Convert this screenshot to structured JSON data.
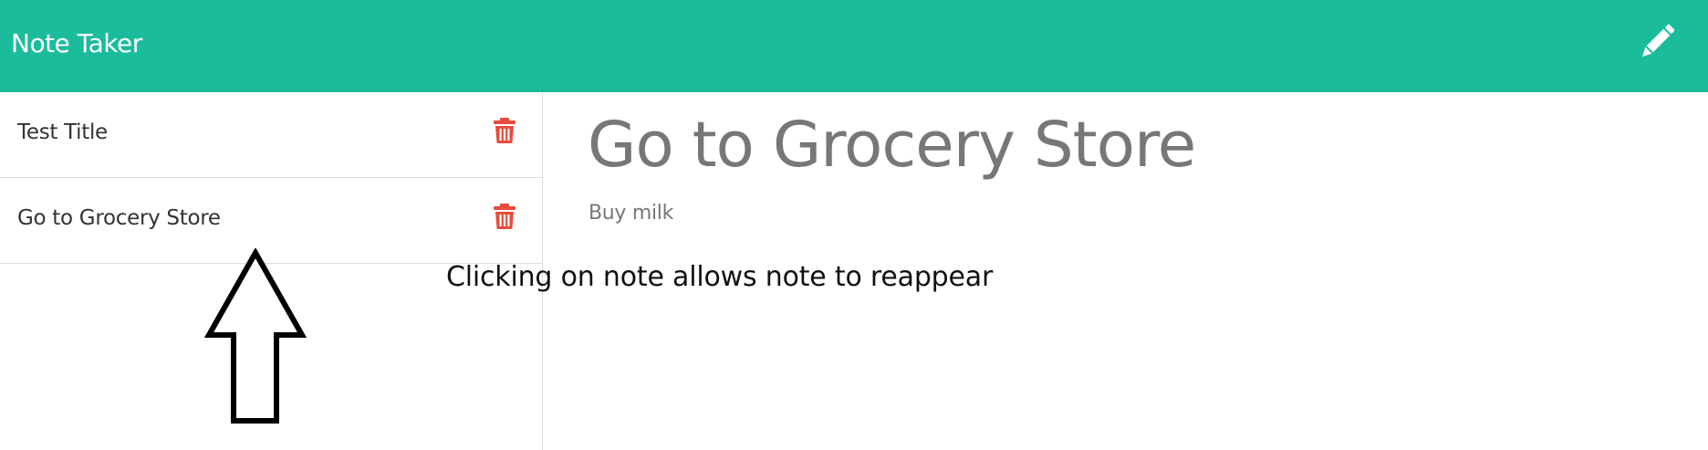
{
  "navbar": {
    "brand": "Note Taker",
    "new_note_icon": "pencil-icon",
    "bg_color": "#1abc9c"
  },
  "sidebar": {
    "notes": [
      {
        "title": "Test Title",
        "delete_icon": "trash-icon"
      },
      {
        "title": "Go to Grocery Store",
        "delete_icon": "trash-icon"
      }
    ],
    "delete_icon_color": "#e74c3c"
  },
  "editor": {
    "title": "Go to Grocery Store",
    "body": "Buy milk"
  },
  "annotation": {
    "text": "Clicking on note allows note to reappear",
    "icon": "up-arrow-icon"
  }
}
